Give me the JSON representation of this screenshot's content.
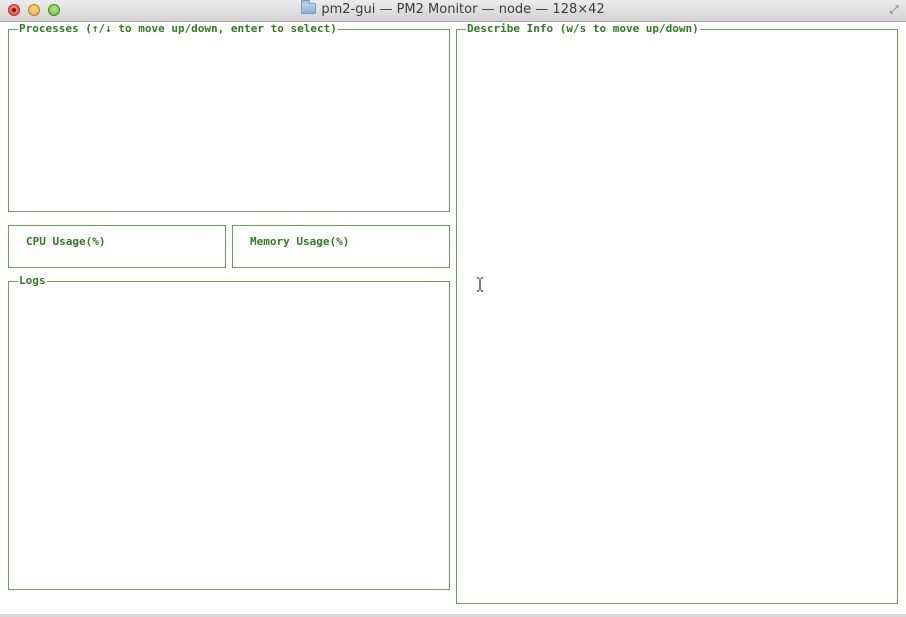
{
  "window": {
    "title": "pm2-gui — PM2 Monitor — node — 128×42"
  },
  "panels": {
    "processes": {
      "label": "Processes (↑/↓ to move up/down, enter to select)"
    },
    "cpu": {
      "label": "CPU Usage(%)"
    },
    "memory": {
      "label": "Memory Usage(%)"
    },
    "logs": {
      "label": "Logs"
    },
    "describe": {
      "label": "Describe Info (w/s to move up/down)"
    }
  },
  "colors": {
    "border": "#6f9a5c",
    "label": "#2e7d1e",
    "background": "#ffffff"
  },
  "icons": {
    "title_folder": "folder-icon",
    "fullscreen": "fullscreen-arrows-icon",
    "pointer": "text-cursor-icon"
  }
}
